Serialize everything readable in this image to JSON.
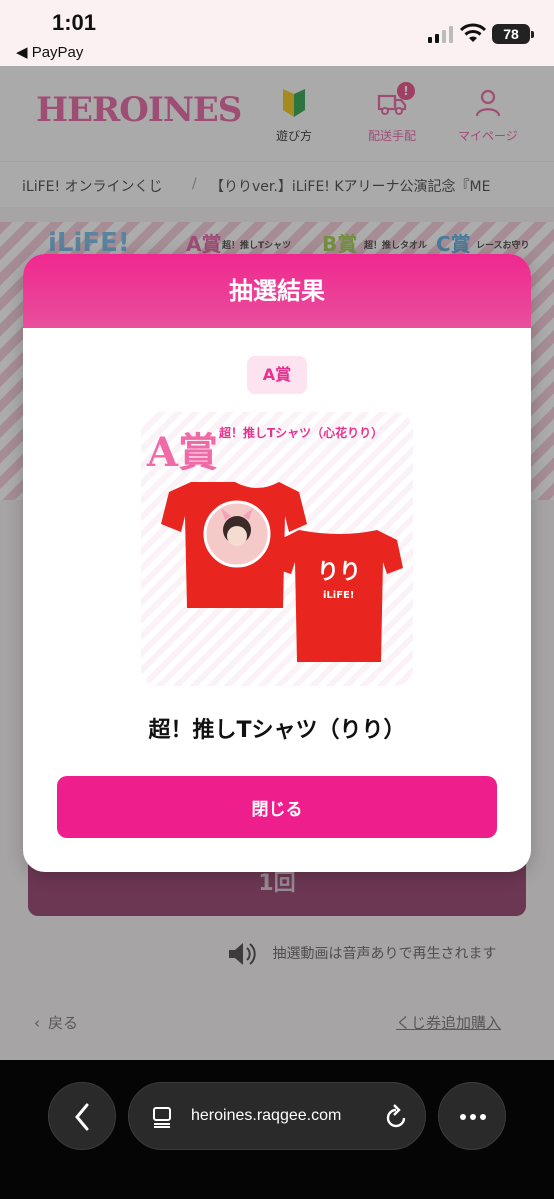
{
  "status_bar": {
    "time": "1:01",
    "back_app": "◀ PayPay",
    "battery": "78"
  },
  "header": {
    "logo": "HEROINES",
    "nav": [
      {
        "label": "遊び方"
      },
      {
        "label": "配送手配",
        "badge": "!"
      },
      {
        "label": "マイページ"
      }
    ]
  },
  "breadcrumb": {
    "items": [
      "iLiFE! オンラインくじ",
      "【りりver.】iLiFE! Kアリーナ公演記念『ME"
    ],
    "separator": "/"
  },
  "banner": {
    "logo_text": "iLiFE!",
    "prizes": [
      {
        "grade": "A賞",
        "text": "超！推しTシャツ"
      },
      {
        "grade": "B賞",
        "text": "超！推しタオル"
      },
      {
        "grade": "C賞",
        "text": "レースお守り"
      }
    ]
  },
  "modal": {
    "title": "抽選結果",
    "prize_grade": "A賞",
    "image": {
      "grade_text": "A賞",
      "caption": "超！推しTシャツ（心花りり）",
      "back_print": "りり",
      "back_brand": "iLiFE!"
    },
    "prize_name": "超！推しTシャツ（りり）",
    "close_label": "閉じる"
  },
  "page": {
    "draw_button": "1回",
    "sound_note": "抽選動画は音声ありで再生されます",
    "back_link": "戻る",
    "add_link": "くじ券追加購入"
  },
  "browser": {
    "url": "heroines.raqgee.com"
  }
}
